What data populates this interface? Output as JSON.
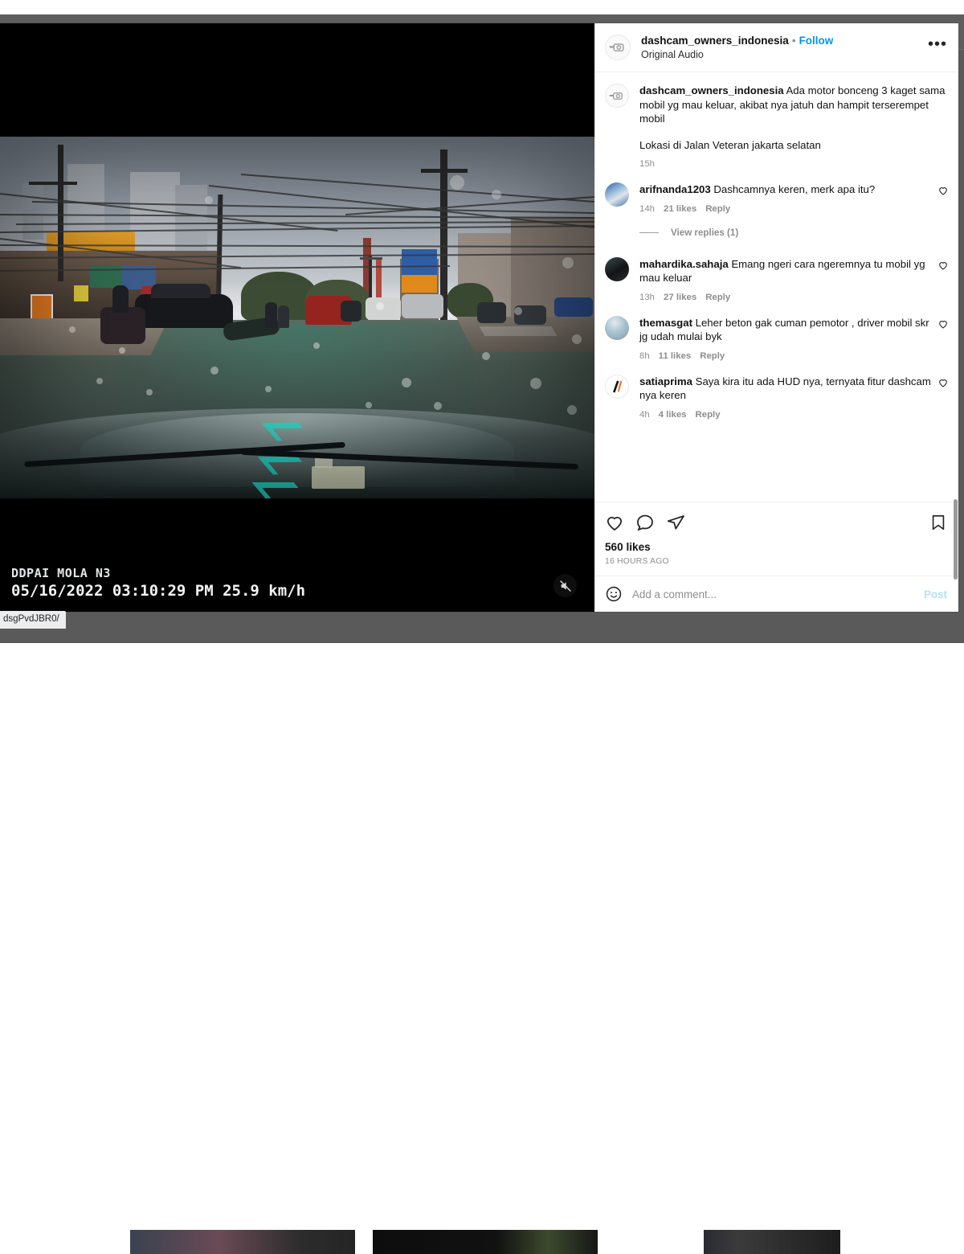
{
  "page": {
    "status_url": "dsgPvdJBR0/"
  },
  "media": {
    "overlay_brand": "DDPAI MOLA N3",
    "overlay_info": "05/16/2022 03:10:29 PM  25.9 km/h",
    "mute_icon": "speaker-muted-icon"
  },
  "header": {
    "username": "dashcam_owners_indonesia",
    "separator": "•",
    "follow_label": "Follow",
    "audio_label": "Original Audio",
    "more_label": "•••"
  },
  "caption": {
    "username": "dashcam_owners_indonesia",
    "text": "Ada motor bonceng 3 kaget sama mobil yg mau keluar, akibat nya jatuh dan hampit terserempet mobil",
    "paragraph2": "Lokasi di Jalan Veteran jakarta selatan",
    "time": "15h"
  },
  "comments": [
    {
      "username": "arifnanda1203",
      "text": "Dashcamnya keren, merk apa itu?",
      "time": "14h",
      "likes": "21 likes",
      "reply": "Reply",
      "replies_label": "View replies (1)",
      "has_replies": true
    },
    {
      "username": "mahardika.sahaja",
      "text": "Emang ngeri cara ngeremnya tu mobil yg mau keluar",
      "time": "13h",
      "likes": "27 likes",
      "reply": "Reply",
      "has_replies": false
    },
    {
      "username": "themasgat",
      "text": "Leher beton gak cuman pemotor , driver mobil skr jg udah mulai byk",
      "time": "8h",
      "likes": "11 likes",
      "reply": "Reply",
      "has_replies": false
    },
    {
      "username": "satiaprima",
      "text": "Saya kira itu ada HUD nya, ternyata fitur dashcam nya keren",
      "time": "4h",
      "likes": "4 likes",
      "reply": "Reply",
      "has_replies": false
    }
  ],
  "actions": {
    "like_icon": "heart-icon",
    "comment_icon": "comment-bubble-icon",
    "share_icon": "share-paperplane-icon",
    "save_icon": "bookmark-icon",
    "likes_count": "560 likes",
    "posted_time": "16 HOURS AGO"
  },
  "add_comment": {
    "emoji_icon": "emoji-smiley-icon",
    "placeholder": "Add a comment...",
    "post_label": "Post"
  },
  "colors": {
    "accent_blue": "#0095f6",
    "post_disabled": "#b2dffc",
    "muted_text": "#8e8e8e",
    "primary_text": "#121212",
    "border": "#efefef",
    "hud_cyan": "#19e6d2"
  }
}
